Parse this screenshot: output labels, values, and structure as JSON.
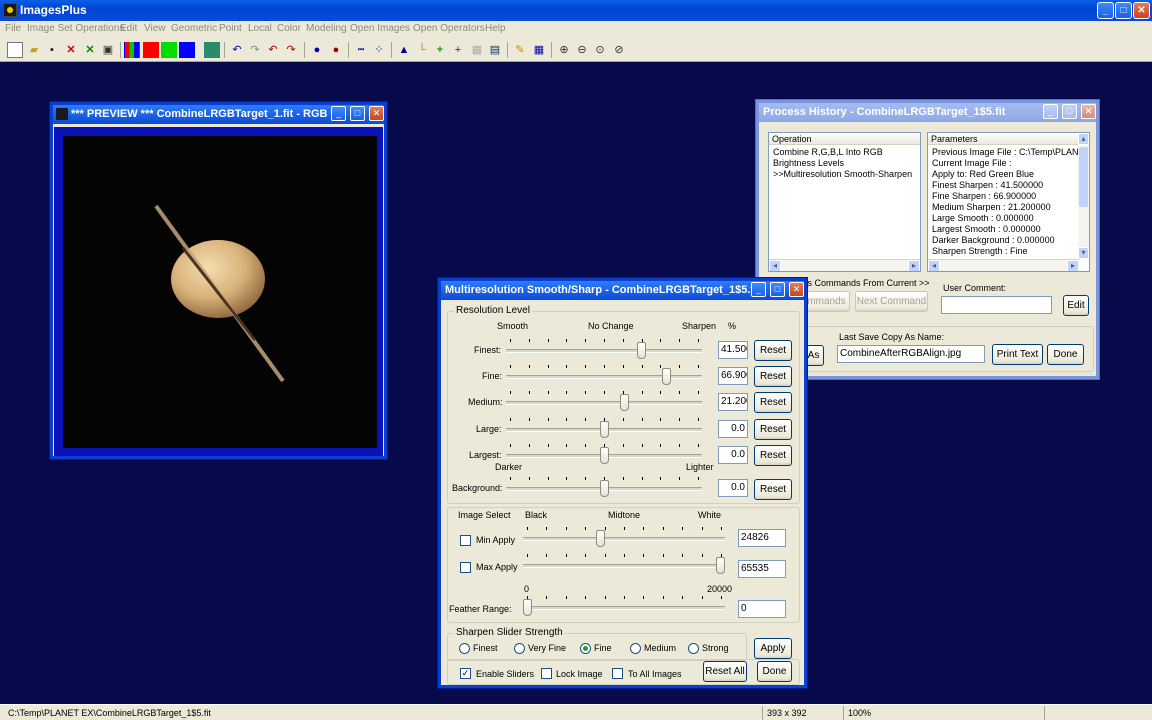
{
  "app": {
    "title": "ImagesPlus"
  },
  "menu": [
    "File",
    "Image Set Operations",
    "Edit",
    "View",
    "Geometric",
    "Point",
    "Local",
    "Color",
    "Modeling",
    "Open Images",
    "Open Operators",
    "Help"
  ],
  "colors": {
    "titlebar": "#0a4bd6",
    "workspace": "#060a4a"
  },
  "preview": {
    "title": "*** PREVIEW *** CombineLRGBTarget_1.fit - RGB ..."
  },
  "history": {
    "title": "Process History - CombineLRGBTarget_1$5.fit",
    "operation_header": "Operation",
    "parameters_header": "Parameters",
    "operations": [
      "Combine R,G,B,L Into RGB",
      "Brightness Levels",
      ">>Multiresolution Smooth-Sharpen"
    ],
    "parameters": [
      "Previous Image File : C:\\Temp\\PLANE",
      "Current Image File :",
      "Apply to:  Red Green Blue",
      "Finest Sharpen : 41.500000",
      "Fine Sharpen : 66.900000",
      "Medium Sharpen : 21.200000",
      "Large Smooth : 0.000000",
      "Largest Smooth : 0.000000",
      "Darker Background : 0.000000",
      "Sharpen Strength : Fine"
    ],
    "process_label": "ss Commands From Current >>",
    "commands_button": "mmands",
    "next_command_button": "Next Command",
    "user_comment_label": "User Comment:",
    "user_comment_value": "",
    "edit_button": "Edit",
    "save_as_button": "As",
    "last_save_label": "Last Save Copy As Name:",
    "last_save_value": "CombineAfterRGBAlign.jpg",
    "print_text_button": "Print Text",
    "done_button": "Done"
  },
  "msharp": {
    "title": "Multiresolution Smooth/Sharp - CombineLRGBTarget_1$5.fit",
    "resolution_group": "Resolution Level",
    "hdr_smooth": "Smooth",
    "hdr_nochange": "No Change",
    "hdr_sharpen": "Sharpen",
    "hdr_percent": "%",
    "sliders": [
      {
        "label": "Finest:",
        "value": "41.500",
        "position": 0.7
      },
      {
        "label": "Fine:",
        "value": "66.900",
        "position": 0.835
      },
      {
        "label": "Medium:",
        "value": "21.200",
        "position": 0.61
      },
      {
        "label": "Large:",
        "value": "0.0",
        "position": 0.5
      },
      {
        "label": "Largest:",
        "value": "0.0",
        "position": 0.5
      }
    ],
    "reset_label": "Reset",
    "darker_label": "Darker",
    "lighter_label": "Lighter",
    "background": {
      "label": "Background:",
      "value": "0.0",
      "position": 0.5
    },
    "image_select_label": "Image Select",
    "black_label": "Black",
    "midtone_label": "Midtone",
    "white_label": "White",
    "min_apply": {
      "label": "Min Apply",
      "value": "24826",
      "checked": false,
      "position": 0.379
    },
    "max_apply": {
      "label": "Max Apply",
      "value": "65535",
      "checked": false,
      "position": 1.0
    },
    "feather_min": "0",
    "feather_max": "20000",
    "feather": {
      "label": "Feather Range:",
      "value": "0",
      "position": 0.0
    },
    "strength_group": "Sharpen Slider Strength",
    "strengths": [
      {
        "label": "Finest",
        "selected": false
      },
      {
        "label": "Very Fine",
        "selected": false
      },
      {
        "label": "Fine",
        "selected": true
      },
      {
        "label": "Medium",
        "selected": false
      },
      {
        "label": "Strong",
        "selected": false
      }
    ],
    "apply_button": "Apply",
    "enable_sliders": {
      "label": "Enable Sliders",
      "checked": true
    },
    "lock_image": {
      "label": "Lock Image",
      "checked": false
    },
    "to_all_images": {
      "label": "To All Images",
      "checked": false
    },
    "reset_all_button": "Reset All",
    "done_button": "Done"
  },
  "status": {
    "path": "C:\\Temp\\PLANET EX\\CombineLRGBTarget_1$5.fit",
    "dims": "393 x 392",
    "zoom": "100%"
  }
}
